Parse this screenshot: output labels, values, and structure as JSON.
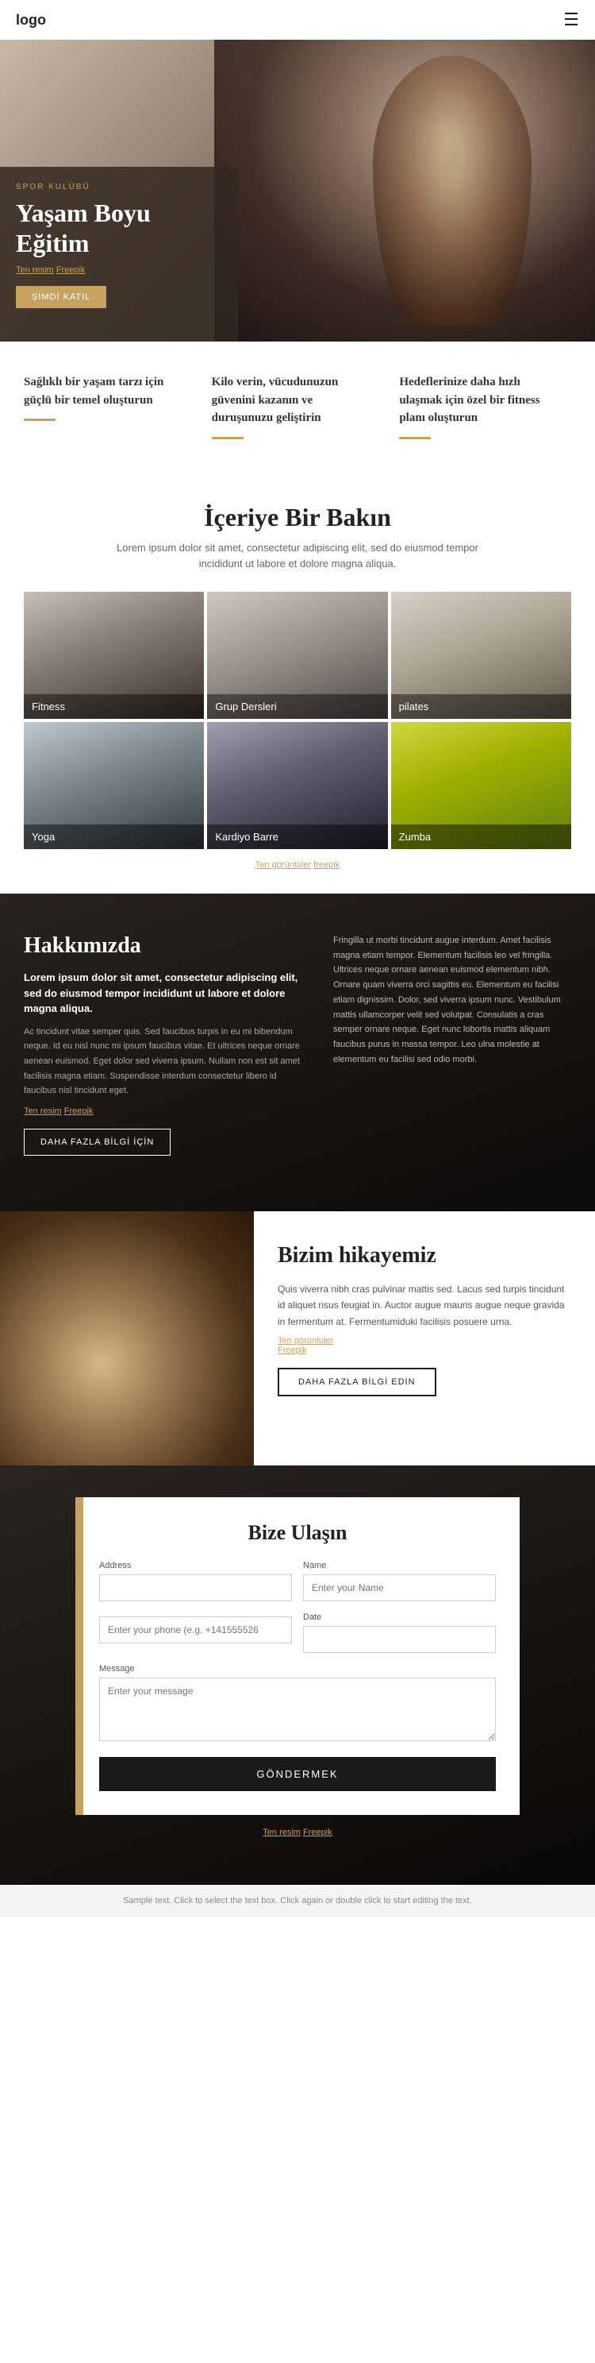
{
  "header": {
    "logo": "logo",
    "menu_icon": "☰"
  },
  "hero": {
    "subtitle": "SPOR KULÜBÜ",
    "title": "Yaşam Boyu\nEğitim",
    "image_credit_prefix": "Ten resim",
    "image_credit_link": "Freepik",
    "button_label": "ŞİMDİ KATIL"
  },
  "features": [
    {
      "text": "Sağlıklı bir yaşam tarzı için güçlü bir temel oluşturun"
    },
    {
      "text": "Kilo verin, vücudunuzun güvenini kazanın ve duruşunuzu geliştirin"
    },
    {
      "text": "Hedeflerinize daha hızlı ulaşmak için özel bir fitness planı oluşturun"
    }
  ],
  "gallery": {
    "title": "İçeriye Bir Bakın",
    "description": "Lorem ipsum dolor sit amet, consectetur adipiscing elit, sed do eiusmod tempor incididunt ut labore et dolore magna aliqua.",
    "items": [
      {
        "label": "Fitness"
      },
      {
        "label": "Grup Dersleri"
      },
      {
        "label": "pilates"
      },
      {
        "label": "Yoga"
      },
      {
        "label": "Kardiyo Barre"
      },
      {
        "label": "Zumba"
      }
    ],
    "source_prefix": "Ten görüntüler",
    "source_link": "freepik"
  },
  "about": {
    "title": "Hakkımızda",
    "subtitle": "Lorem ipsum dolor sit amet, consectetur adipiscing elit, sed do eiusmod tempor incididunt ut labore et dolore magna aliqua.",
    "text1": "Ac tincidunt vitae semper quis. Sed faucibus turpis in eu mi bibendum neque. Id eu nisl nunc mi ipsum faucibus vitae. Et ultrices neque ornare aenean euismod. Eget dolor sed viverra ipsum. Nullam non est sit amet facilisis magna etiam. Suspendisse interdum consectetur libero id faucibus nisl tincidunt eget.",
    "source_prefix": "Ten resim",
    "source_link": "Freepik",
    "button_label": "DAHA FAZLA BİLGİ İÇİN",
    "right_text": "Fringilla ut morbi tincidunt augue interdum. Amet facilisis magna etiam tempor. Elementum facilisis leo vel fringilla. Ultrices neque ornare aenean euismod elementum nibh. Ornare quam viverra orci sagittis eu. Elementum eu facilisi etiam dignissim. Dolor, sed viverra ipsum nunc. Vestibulum mattis ullamcorper velit sed volutpat. Consulatis a cras semper ornare neque. Eget nunc lobortis mattis aliquam faucibus purus in massa tempor. Leo ulna molestie at elementum eu facilisi sed odio morbi."
  },
  "story": {
    "title": "Bizim hikayemiz",
    "text1": "Quis viverra nibh cras pulvinar mattis sed. Lacus sed turpis tincidunt id aliquet risus feugiat in. Auctor augue mauris augue neque gravida in fermentum at. Fermentumiduki facilisis posuere urna.",
    "source_prefix": "Ten görüntüler",
    "source_link": "Freepik",
    "button_label": "DAHA FAZLA BİLGİ EDİN"
  },
  "contact": {
    "title": "Bize Ulaşın",
    "form": {
      "address_label": "Address",
      "address_placeholder": "",
      "name_label": "Name",
      "name_placeholder": "Enter your Name",
      "phone_label": "",
      "phone_placeholder": "Enter your phone (e.g. +141555526",
      "date_label": "Date",
      "date_placeholder": "",
      "message_label": "Message",
      "message_placeholder": "Enter your message",
      "submit_label": "GÖNDERMEK"
    },
    "source_prefix": "Ten resim",
    "source_link": "Freepik"
  },
  "footer": {
    "note": "Sample text. Click to select the text box. Click again or double click to start editing the text."
  }
}
